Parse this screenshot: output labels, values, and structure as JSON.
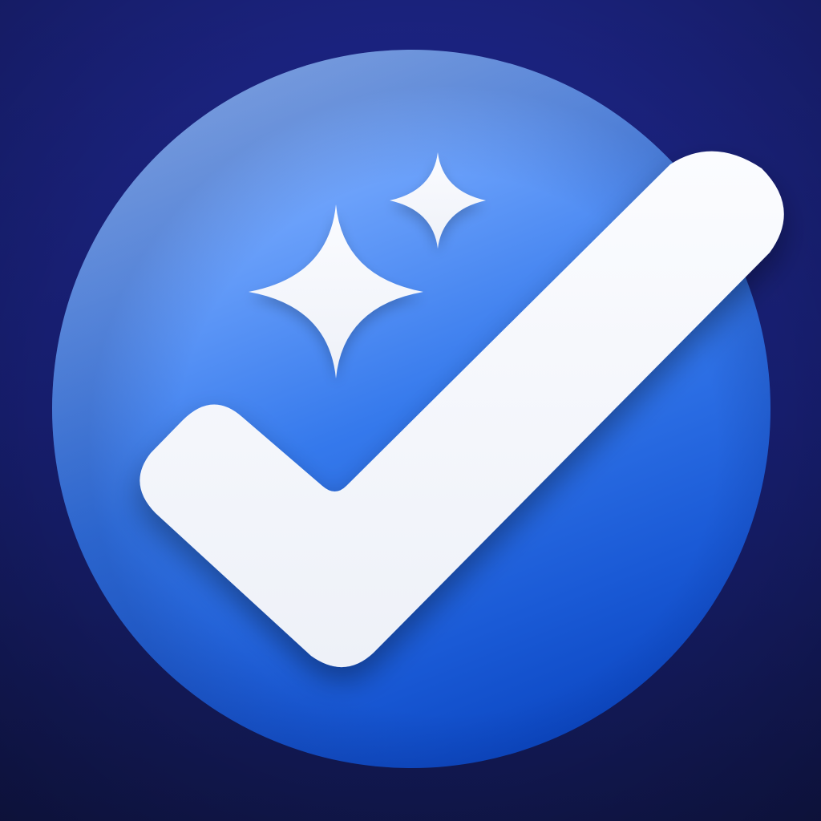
{
  "icon": {
    "name": "checkmark-sparkles-app-icon",
    "colors": {
      "background_top": "#1b2380",
      "background_bottom": "#101649",
      "circle_top": "#8cb8ff",
      "circle_mid": "#3f82f0",
      "circle_bottom": "#0b48c4",
      "glyph": "#f4f6fb"
    },
    "elements": [
      "circle-badge",
      "checkmark-icon",
      "large-sparkle-icon",
      "small-sparkle-icon"
    ]
  }
}
